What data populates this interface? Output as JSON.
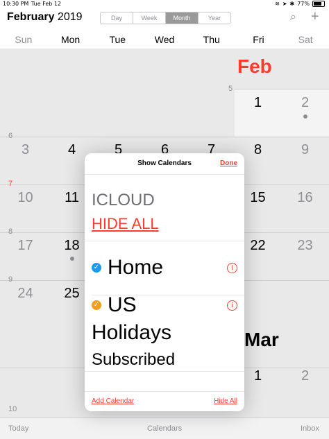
{
  "status": {
    "time": "10:30 PM",
    "date": "Tue Feb 12",
    "battery": "77%"
  },
  "header": {
    "title_month": "February",
    "title_year": "2019",
    "views": [
      "Day",
      "Week",
      "Month",
      "Year"
    ],
    "active_view": "Month"
  },
  "weekdays": [
    "Sun",
    "Mon",
    "Tue",
    "Wed",
    "Thu",
    "Fri",
    "Sat"
  ],
  "calendar": {
    "month_label": "Feb",
    "next_month_label": "Mar",
    "week_numbers": [
      "5",
      "6",
      "7",
      "8",
      "9",
      "10"
    ],
    "rows": [
      [
        "",
        "",
        "",
        "",
        "",
        "1",
        "2"
      ],
      [
        "3",
        "4",
        "5",
        "6",
        "7",
        "8",
        "9"
      ],
      [
        "10",
        "11",
        "",
        "",
        "",
        "15",
        "16"
      ],
      [
        "17",
        "18",
        "",
        "",
        "",
        "22",
        "23"
      ],
      [
        "24",
        "25",
        "",
        "",
        "",
        "",
        ""
      ],
      [
        "",
        "",
        "",
        "",
        "",
        "1",
        "2"
      ]
    ]
  },
  "popover": {
    "title": "Show Calendars",
    "done": "Done",
    "section": "ICLOUD",
    "hide_all": "HIDE ALL",
    "calendars": [
      {
        "name": "Home",
        "color": "#1a9bef"
      },
      {
        "name": "US",
        "color": "#f29d1d"
      }
    ],
    "holidays": "Holidays",
    "subscribed": "Subscribed",
    "add_calendar": "Add Calendar",
    "hide_all_footer": "Hide All"
  },
  "tabbar": {
    "today": "Today",
    "calendars": "Calendars",
    "inbox": "Inbox"
  }
}
